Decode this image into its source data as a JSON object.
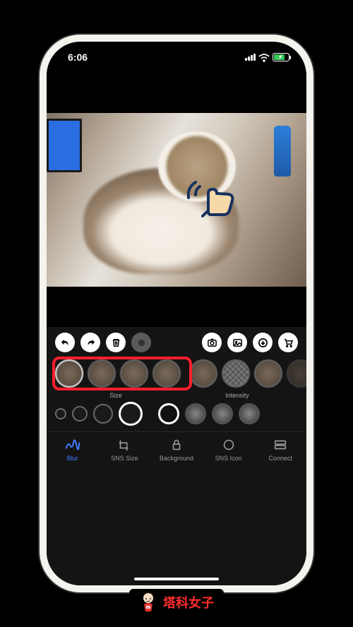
{
  "status": {
    "time": "6:06",
    "location_icon": "location-arrow",
    "battery_charging": true
  },
  "photo": {
    "subject": "cat-on-desk",
    "overlay_icon": "tap-gesture-hand"
  },
  "toolbar": {
    "undo": "undo-icon",
    "redo": "redo-icon",
    "trash": "trash-icon",
    "preview": "circle-icon",
    "camera": "camera-icon",
    "gallery": "image-icon",
    "download": "download-icon",
    "cart": "cart-icon"
  },
  "blur_section": {
    "size_label": "Size",
    "intensity_label": "Intensity",
    "style_count": 8,
    "selected_style_index": 0,
    "highlighted_range": 4,
    "size_options": 4,
    "size_selected_index": 3,
    "intensity_options": 4,
    "intensity_selected_index": 0
  },
  "tabs": {
    "items": [
      {
        "label": "Blur",
        "icon": "scribble-icon",
        "active": true
      },
      {
        "label": "SNS Size",
        "icon": "crop-icon",
        "active": false
      },
      {
        "label": "Background",
        "icon": "lock-icon",
        "active": false
      },
      {
        "label": "SNS Icon",
        "icon": "circle-icon",
        "active": false
      },
      {
        "label": "Connect",
        "icon": "grid-icon",
        "active": false
      }
    ]
  },
  "watermark": {
    "text": "塔科女子"
  },
  "colors": {
    "accent": "#3e7bff",
    "highlight": "#ff1e2d",
    "battery": "#34c759"
  }
}
